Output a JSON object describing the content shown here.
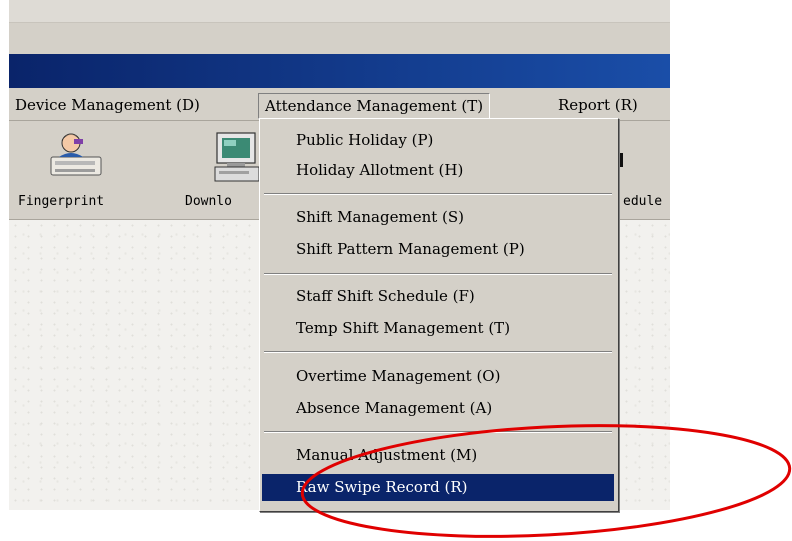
{
  "menubar": {
    "items": [
      {
        "label": "Device Management (D)"
      },
      {
        "label": "Attendance Management (T)"
      },
      {
        "label": "Report (R)"
      }
    ]
  },
  "toolbar": {
    "buttons": [
      {
        "label": "Fingerprint",
        "icon": "person-fingerprint-icon"
      },
      {
        "label": "Downlo",
        "icon": "computer-download-icon"
      },
      {
        "label": "edule",
        "icon": "schedule-icon"
      }
    ]
  },
  "dropdown": {
    "items": [
      {
        "label": "Public Holiday (P)"
      },
      {
        "label": "Holiday Allotment (H)"
      },
      {
        "label": "Shift Management (S)"
      },
      {
        "label": "Shift Pattern Management (P)"
      },
      {
        "label": "Staff Shift Schedule (F)"
      },
      {
        "label": "Temp Shift Management (T)"
      },
      {
        "label": "Overtime Management (O)"
      },
      {
        "label": "Absence Management (A)"
      },
      {
        "label": "Manual Adjustment (M)"
      },
      {
        "label": "Raw Swipe Record (R)"
      }
    ]
  },
  "colors": {
    "highlight": "#0a246a",
    "annotation": "#e00000",
    "titlebar": "#0a246a"
  }
}
